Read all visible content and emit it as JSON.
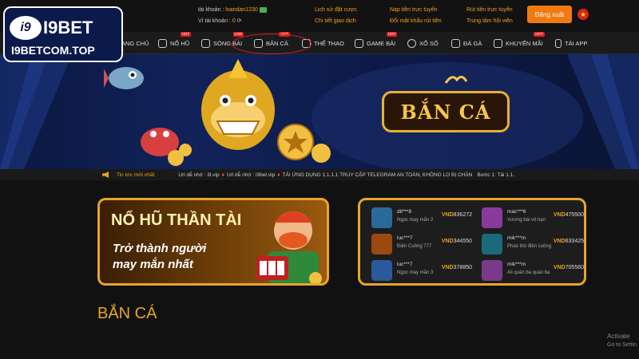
{
  "brand": {
    "short": "i9",
    "name": "I9BET",
    "site": "I9BETCOM.TOP"
  },
  "account": {
    "username_label": "tài khoản :",
    "username": "loandan1230",
    "wallet_label": "Ví tài khoản :",
    "wallet": "0"
  },
  "header_links": [
    "Lịch sử đặt cược",
    "Chi tiết giao dịch",
    "Nạp tiền trực tuyến",
    "Đổi mật khẩu rút tiền",
    "Rút tiền trực tuyến",
    "Trung tâm hội viên"
  ],
  "logout_label": "Đăng xuất",
  "nav": [
    {
      "label": "TRANG CHỦ",
      "badge": ""
    },
    {
      "label": "NỔ HŨ",
      "badge": "HOT"
    },
    {
      "label": "SÒNG BÀI",
      "badge": "LIVE"
    },
    {
      "label": "BẮN CÁ",
      "badge": "HOT"
    },
    {
      "label": "THỂ THAO",
      "badge": ""
    },
    {
      "label": "GAME BÀI",
      "badge": "HOT"
    },
    {
      "label": "XỔ SỐ",
      "badge": ""
    },
    {
      "label": "ĐÁ GÀ",
      "badge": ""
    },
    {
      "label": "KHUYẾN MÃI",
      "badge": "HOT"
    },
    {
      "label": "TẢI APP",
      "badge": ""
    }
  ],
  "banner": {
    "title": "BẮN CÁ"
  },
  "ticker": {
    "label": "Tin tức mới nhất",
    "items": [
      "Url dễ nhớ : i9.vip",
      "Url dễ nhớ : i9bet.vip",
      "TẢI ỨNG DỤNG 1.1.1.1 TRUY CẬP TELEGRAM AN TOÀN, KHÔNG LO BỊ CHẶN",
      "Bước 1: Tải 1.1."
    ]
  },
  "promo": {
    "line1": "NỔ HŨ THẦN TÀI",
    "line2": "Trở thành người",
    "line3": "may mắn nhất"
  },
  "jackpots": [
    {
      "user": "dtl***8",
      "game": "Ngọc may mắn 2",
      "currency": "VND",
      "amount": "836272",
      "color": "#2a6a9a"
    },
    {
      "user": "mac***6",
      "game": "Vương bài vô hạn",
      "currency": "VND",
      "amount": "475500",
      "color": "#8a3a9a"
    },
    {
      "user": "luc***7",
      "game": "Điên Cuồng 777",
      "currency": "VND",
      "amount": "344550",
      "color": "#9a4a10"
    },
    {
      "user": "mik***m",
      "game": "Pháo thủ điên cuồng",
      "currency": "VND",
      "amount": "633425",
      "color": "#1a6a7a"
    },
    {
      "user": "luc***7",
      "game": "Ngọc may mắn 3",
      "currency": "VND",
      "amount": "378850",
      "color": "#2a5a9a"
    },
    {
      "user": "mik***m",
      "game": "Ali quán ba quán ba",
      "currency": "VND",
      "amount": "705560",
      "color": "#7a3a8a"
    }
  ],
  "section_title": "BẮN CÁ",
  "watermark": {
    "line1": "Activate",
    "line2": "Go to Settin"
  }
}
